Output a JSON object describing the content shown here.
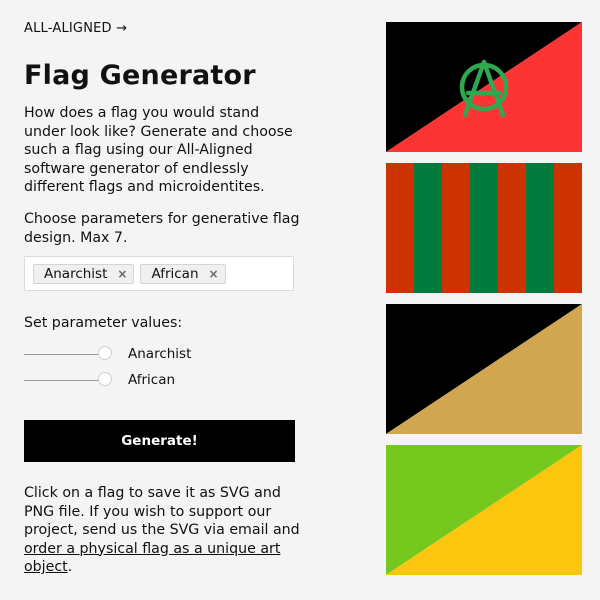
{
  "header": {
    "brand_link": "ALL-ALIGNED →"
  },
  "main": {
    "title": "Flag Generator",
    "intro": "How does a flag you would stand under look like? Generate and choose such a flag using our All-Aligned software generator of endlessly different flags and microidentites.",
    "choose_text": "Choose parameters for generative flag design. Max 7.",
    "selected_tags": [
      {
        "label": "Anarchist",
        "remove_glyph": "×"
      },
      {
        "label": "African",
        "remove_glyph": "×"
      }
    ],
    "set_values_label": "Set parameter values:",
    "sliders": [
      {
        "label": "Anarchist",
        "value": 1.0
      },
      {
        "label": "African",
        "value": 1.0
      }
    ],
    "generate_label": "Generate!",
    "outro_text": "Click on a flag to save it as SVG and PNG file. If you wish to support our project, send us the SVG via email and ",
    "outro_link": "order a physical flag as a unique art object",
    "outro_end": "."
  },
  "flags": [
    {
      "kind": "diagonal-emblem",
      "colors": {
        "top_left": "#000000",
        "bottom_right": "#fc3434",
        "emblem": "#2fa84f"
      },
      "icon": "anarchy-a-icon"
    },
    {
      "kind": "vertical-stripes",
      "colors": {
        "stripe_a": "#cc3300",
        "stripe_b": "#007a3d"
      },
      "stripe_count": 7
    },
    {
      "kind": "diagonal",
      "colors": {
        "top_left": "#000000",
        "bottom_right": "#d0a750"
      }
    },
    {
      "kind": "diagonal",
      "colors": {
        "top_left": "#75c91e",
        "bottom_right": "#fdc60e"
      }
    }
  ]
}
